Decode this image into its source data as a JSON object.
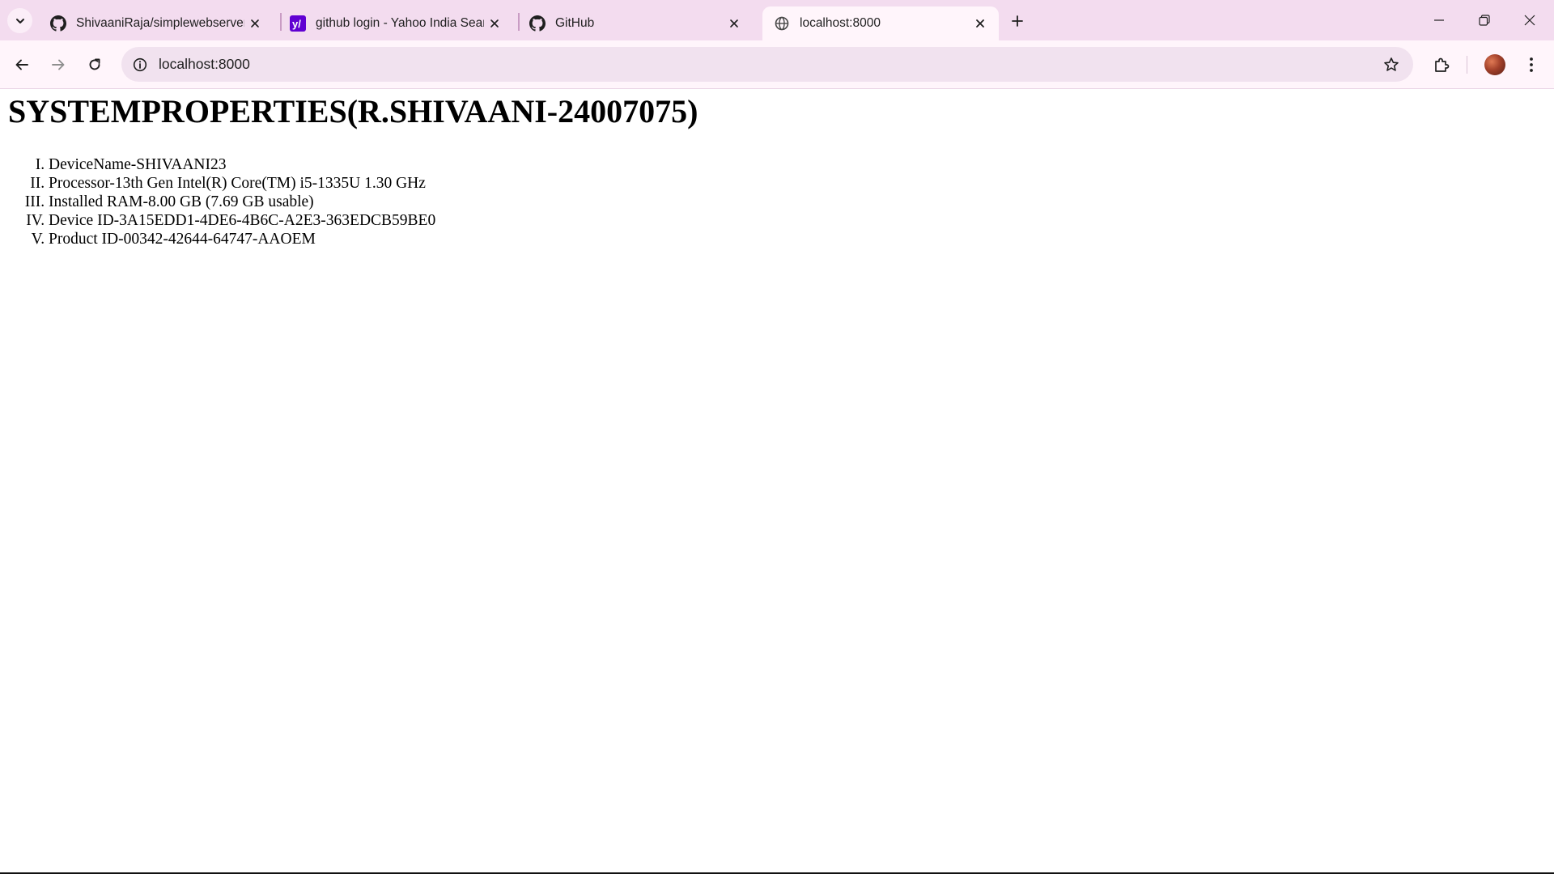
{
  "browser": {
    "tabs": [
      {
        "title": "ShivaaniRaja/simplewebserver",
        "icon": "github-icon",
        "active": false
      },
      {
        "title": "github login - Yahoo India Search",
        "icon": "yahoo-icon",
        "active": false
      },
      {
        "title": "GitHub",
        "icon": "github-icon",
        "active": false
      },
      {
        "title": "localhost:8000",
        "icon": "globe-icon",
        "active": true
      }
    ],
    "address": "localhost:8000"
  },
  "page": {
    "heading": "SYSTEMPROPERTIES(R.SHIVAANI-24007075)",
    "items": [
      "DeviceName-SHIVAANI23",
      "Processor-13th Gen Intel(R) Core(TM) i5-1335U 1.30 GHz",
      "Installed RAM-8.00 GB (7.69 GB usable)",
      "Device ID-3A15EDD1-4DE6-4B6C-A2E3-363EDCB59BE0",
      "Product ID-00342-42644-64747-AAOEM"
    ]
  }
}
